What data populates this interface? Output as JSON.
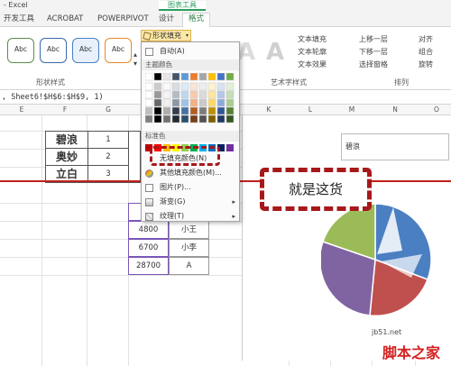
{
  "window": {
    "title": "- Excel",
    "context_tab_group": "图表工具"
  },
  "tabs": [
    {
      "label": "开发工具",
      "active": false
    },
    {
      "label": "ACROBAT",
      "active": false
    },
    {
      "label": "POWERPIVOT",
      "active": false
    },
    {
      "label": "设计",
      "active": false
    },
    {
      "label": "格式",
      "active": true
    }
  ],
  "ribbon": {
    "shape_styles": [
      "Abc",
      "Abc",
      "Abc",
      "Abc"
    ],
    "shape_style_colors": [
      "#5a8f4a",
      "#3a6aa8",
      "#4a7fc2",
      "#e68a2a"
    ],
    "group_shape_styles": "形状样式",
    "group_art_text": "艺术字样式",
    "group_arrange": "排列",
    "fill_button": "形状填充",
    "outline_items": [
      "文本填充",
      "文本轮廓",
      "文本效果"
    ],
    "arrange_items": [
      "上移一层",
      "下移一层",
      "选择窗格"
    ],
    "align_items": [
      "对齐",
      "组合",
      "旋转"
    ]
  },
  "formula_bar": {
    "text": ", Sheet6!$H$6:$H$9, 1)"
  },
  "columns": [
    "E",
    "F",
    "G",
    "K",
    "L",
    "M",
    "N",
    "O"
  ],
  "table_left": {
    "rows": [
      {
        "name": "碧浪",
        "value": "1"
      },
      {
        "name": "奥妙",
        "value": "2"
      },
      {
        "name": "立白",
        "value": "3"
      }
    ]
  },
  "table_right": {
    "rows": [
      {
        "value": "4800",
        "name": "小王"
      },
      {
        "value": "6700",
        "name": "小李"
      },
      {
        "value": "28700",
        "name": "A"
      }
    ]
  },
  "chart": {
    "dropdown_label": "碧浪"
  },
  "menu": {
    "auto_label": "自动(A)",
    "theme_colors_label": "主题颜色",
    "standard_colors_label": "标准色",
    "no_fill_label": "无填充颜色(N)",
    "more_fill_label": "其他填充颜色(M)...",
    "picture_label": "图片(P)...",
    "gradient_label": "渐变(G)",
    "texture_label": "纹理(T)",
    "theme_colors": [
      "#ffffff",
      "#000000",
      "#e7e6e6",
      "#44546a",
      "#5b9bd5",
      "#ed7d31",
      "#a5a5a5",
      "#ffc000",
      "#4472c4",
      "#70ad47"
    ],
    "standard_colors": [
      "#c00000",
      "#ff0000",
      "#ffc000",
      "#ffff00",
      "#92d050",
      "#00b050",
      "#00b0f0",
      "#0070c0",
      "#002060",
      "#7030a0"
    ]
  },
  "callout": {
    "text": "就是这货"
  },
  "watermark": {
    "url": "jb51.net",
    "name": "脚本之家"
  },
  "pie_colors": [
    "#4472c4",
    "#c0504d",
    "#9bbb59",
    "#8064a2"
  ]
}
